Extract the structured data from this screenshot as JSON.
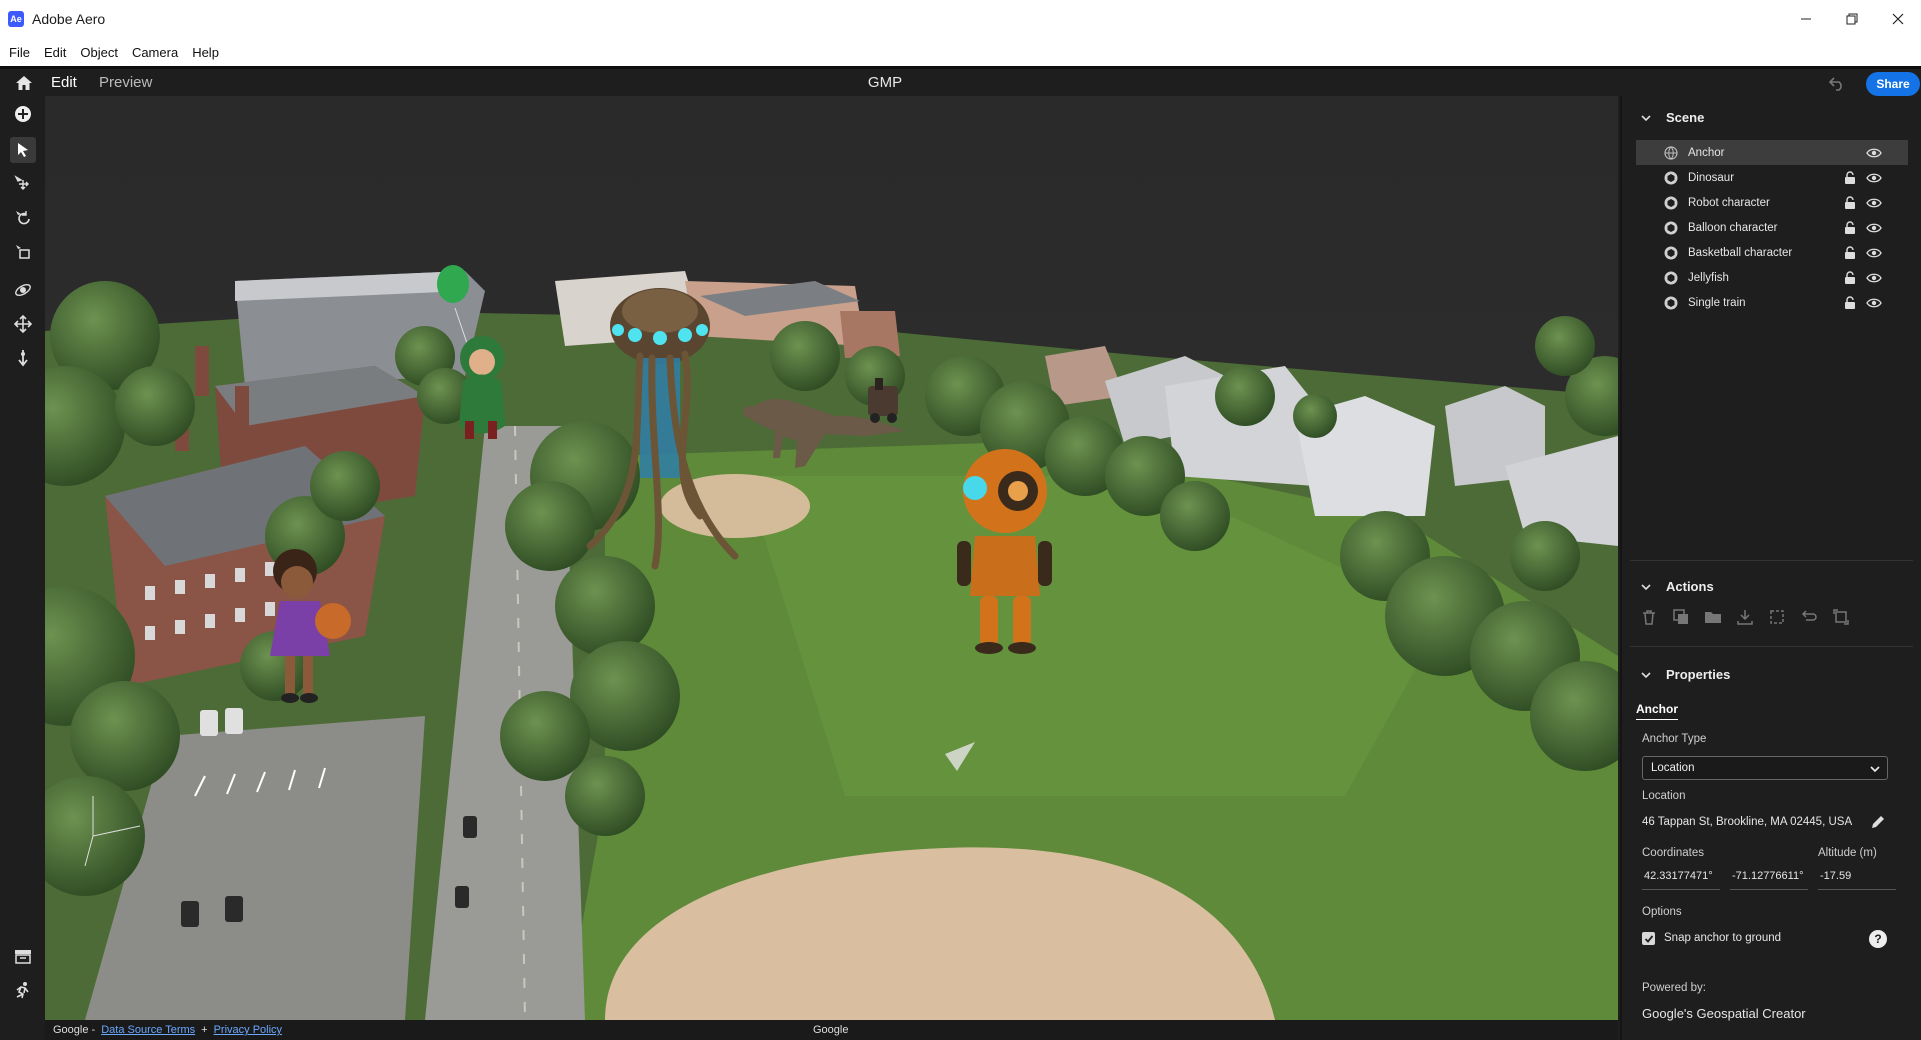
{
  "window": {
    "title": "Adobe Aero",
    "app_icon": "Ae"
  },
  "menu": [
    "File",
    "Edit",
    "Object",
    "Camera",
    "Help"
  ],
  "header": {
    "tabs": [
      {
        "label": "Edit",
        "active": true
      },
      {
        "label": "Preview",
        "active": false
      }
    ],
    "doc_title": "GMP",
    "share_label": "Share"
  },
  "toolbar": {
    "tools": [
      "add-icon",
      "select-icon",
      "move-icon",
      "rotate-icon",
      "scale-icon",
      "orbit-icon",
      "pan-icon",
      "dolly-icon",
      "library-icon",
      "behavior-icon"
    ]
  },
  "viewport": {
    "footer": {
      "google": "Google -",
      "data_terms": "Data Source Terms",
      "plus": "+",
      "privacy": "Privacy Policy",
      "center": "Google"
    }
  },
  "panel": {
    "scene": {
      "title": "Scene",
      "items": [
        {
          "label": "Anchor",
          "icon": "globe-icon",
          "lock": false,
          "selected": true
        },
        {
          "label": "Dinosaur",
          "icon": "cube-icon",
          "lock": true,
          "selected": false
        },
        {
          "label": "Robot character",
          "icon": "cube-icon",
          "lock": true,
          "selected": false
        },
        {
          "label": "Balloon character",
          "icon": "cube-icon",
          "lock": true,
          "selected": false
        },
        {
          "label": "Basketball character",
          "icon": "cube-icon",
          "lock": true,
          "selected": false
        },
        {
          "label": "Jellyfish",
          "icon": "cube-icon",
          "lock": true,
          "selected": false
        },
        {
          "label": "Single train",
          "icon": "cube-icon",
          "lock": true,
          "selected": false
        }
      ]
    },
    "actions": {
      "title": "Actions",
      "icons": [
        "trash-icon",
        "duplicate-icon",
        "folder-icon",
        "download-icon",
        "group-icon",
        "reset-icon",
        "replace-icon"
      ]
    },
    "properties": {
      "title": "Properties",
      "subtab": "Anchor",
      "anchor_type_label": "Anchor Type",
      "anchor_type_value": "Location",
      "location_label": "Location",
      "location_value": "46 Tappan St, Brookline, MA 02445, USA",
      "coordinates_label": "Coordinates",
      "altitude_label": "Altitude (m)",
      "latitude": "42.33177471°",
      "longitude": "-71.12776611°",
      "altitude": "-17.59",
      "options_label": "Options",
      "snap_label": "Snap anchor to ground",
      "snap_checked": true,
      "powered_by_label": "Powered by:",
      "powered_by_value": "Google's Geospatial Creator"
    }
  },
  "colors": {
    "accent": "#1473e6",
    "panel_bg": "#1e1e1e",
    "grass": "#5e8a3a",
    "dirt": "#d9bfa0"
  }
}
